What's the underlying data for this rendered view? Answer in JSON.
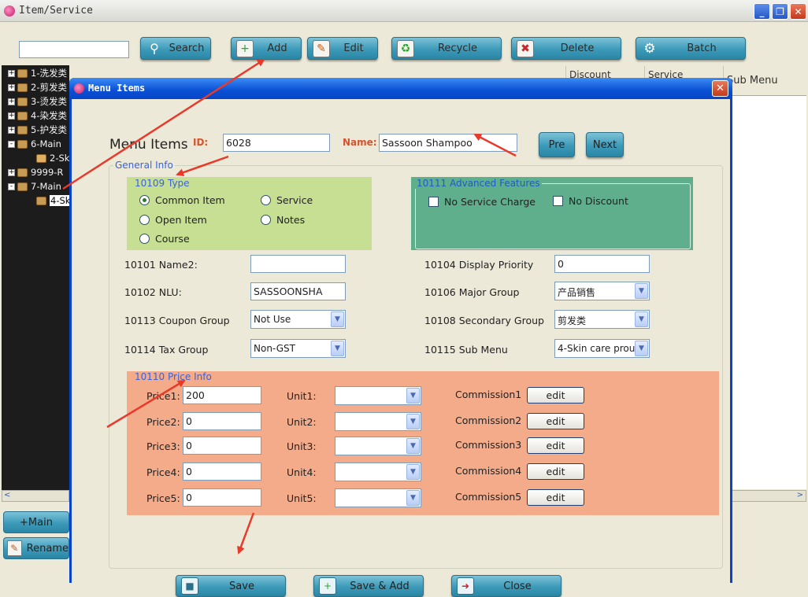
{
  "window": {
    "title": "Item/Service"
  },
  "toolbar": {
    "search_value": "",
    "buttons": [
      {
        "label": "Search",
        "icon": "magnifier-icon"
      },
      {
        "label": "Add",
        "icon": "add-document-icon"
      },
      {
        "label": "Edit",
        "icon": "edit-pencil-icon"
      },
      {
        "label": "Recycle",
        "icon": "recycle-bin-icon"
      },
      {
        "label": "Delete",
        "icon": "delete-trash-icon"
      },
      {
        "label": "Batch",
        "icon": "gear-icon"
      }
    ]
  },
  "tree": [
    {
      "label": "1-洗发类",
      "expander": "+"
    },
    {
      "label": "2-剪发类",
      "expander": "+"
    },
    {
      "label": "3-烫发类",
      "expander": "+"
    },
    {
      "label": "4-染发类",
      "expander": "+"
    },
    {
      "label": "5-护发类",
      "expander": "+"
    },
    {
      "label": "6-Main",
      "expander": "-"
    },
    {
      "label": "2-Sk",
      "expander": ""
    },
    {
      "label": "9999-R",
      "expander": "+"
    },
    {
      "label": "7-Main",
      "expander": "-"
    },
    {
      "label": "4-Sk",
      "expander": ""
    }
  ],
  "sidebar_buttons": {
    "main": "+Main",
    "rename": "Rename"
  },
  "grid_headers": [
    "Discount",
    "Service",
    "Sub Menu"
  ],
  "dialog": {
    "title": "Menu Items",
    "heading": "Menu Items",
    "id_label": "ID:",
    "id_value": "6028",
    "name_label": "Name:",
    "name_value": "Sassoon Shampoo",
    "pre": "Pre",
    "next": "Next",
    "general_info": "General Info",
    "type": {
      "legend": "10109 Type",
      "options": [
        "Common Item",
        "Service",
        "Open Item",
        "Notes",
        "Course"
      ],
      "selected": "Common Item"
    },
    "advanced": {
      "legend": "10111 Advanced Features",
      "no_service_charge": "No Service Charge",
      "no_discount": "No Discount"
    },
    "fields": {
      "name2_label": "10101 Name2:",
      "name2_value": "",
      "nlu_label": "10102 NLU:",
      "nlu_value": "SASSOONSHA",
      "coupon_label": "10113 Coupon Group",
      "coupon_value": "Not Use",
      "tax_label": "10114 Tax Group",
      "tax_value": "Non-GST",
      "priority_label": "10104 Display Priority",
      "priority_value": "0",
      "major_label": "10106 Major Group",
      "major_value": "产品销售",
      "secondary_label": "10108 Secondary Group",
      "secondary_value": "剪发类",
      "submenu_label": "10115 Sub Menu",
      "submenu_value": "4-Skin care prou"
    },
    "price_info": {
      "legend": "10110 Price Info",
      "rows": [
        {
          "price_label": "Price1:",
          "price": "200",
          "unit_label": "Unit1:",
          "unit": "",
          "commission_label": "Commission1",
          "edit": "edit"
        },
        {
          "price_label": "Price2:",
          "price": "0",
          "unit_label": "Unit2:",
          "unit": "",
          "commission_label": "Commission2",
          "edit": "edit"
        },
        {
          "price_label": "Price3:",
          "price": "0",
          "unit_label": "Unit3:",
          "unit": "",
          "commission_label": "Commission3",
          "edit": "edit"
        },
        {
          "price_label": "Price4:",
          "price": "0",
          "unit_label": "Unit4:",
          "unit": "",
          "commission_label": "Commission4",
          "edit": "edit"
        },
        {
          "price_label": "Price5:",
          "price": "0",
          "unit_label": "Unit5:",
          "unit": "",
          "commission_label": "Commission5",
          "edit": "edit"
        }
      ]
    },
    "bottom_buttons": {
      "save": "Save",
      "save_add": "Save & Add",
      "close": "Close"
    }
  },
  "colors": {
    "accent_blue": "#0a4fd4",
    "type_bg": "#c6df93",
    "advanced_bg": "#5fae8c",
    "price_bg": "#f3ab8a",
    "arrow": "#e8392a"
  }
}
